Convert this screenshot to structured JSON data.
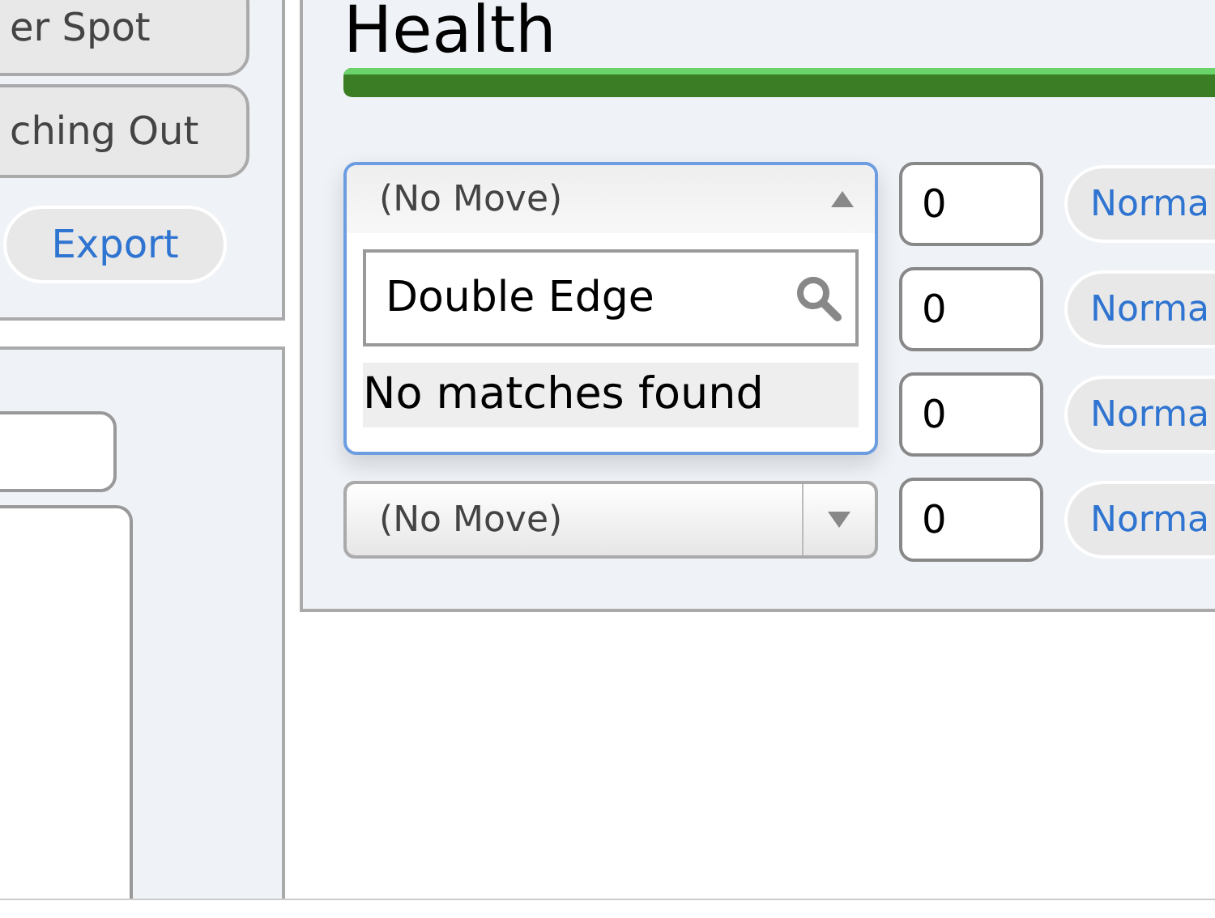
{
  "sidebar": {
    "buttons": [
      {
        "label": "er Spot",
        "kind": "plain"
      },
      {
        "label": "ching Out",
        "kind": "plain"
      },
      {
        "label": "Export",
        "kind": "link"
      }
    ]
  },
  "health": {
    "title": "Health",
    "level": 1
  },
  "moves": [
    {
      "select": {
        "value": "(No Move)",
        "expanded": true,
        "search": "Double Edge",
        "message": "No matches found"
      },
      "pp": "0",
      "type": "Norma"
    },
    {
      "pp": "0",
      "type": "Norma"
    },
    {
      "pp": "0",
      "type": "Norma"
    },
    {
      "select": {
        "value": "(No Move)",
        "expanded": false
      },
      "pp": "0",
      "type": "Norma"
    }
  ]
}
